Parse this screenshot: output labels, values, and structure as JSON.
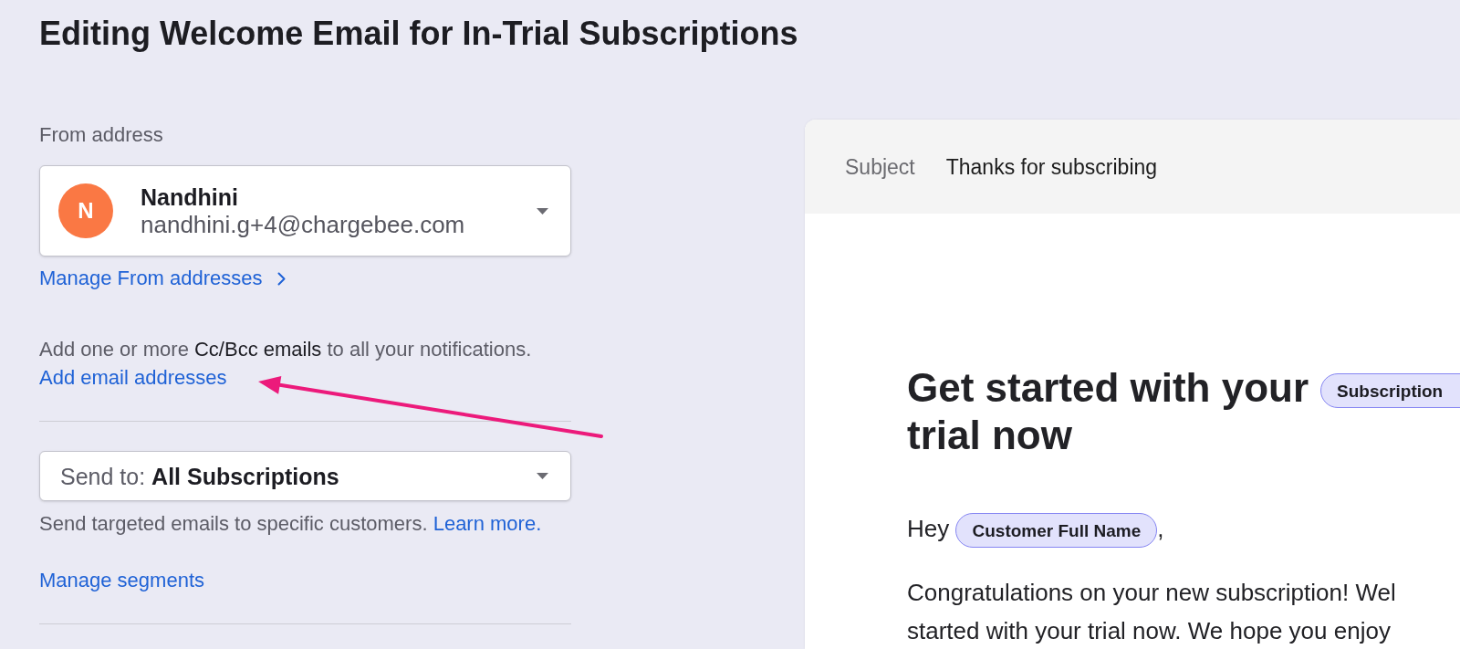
{
  "page": {
    "title": "Editing Welcome Email for In-Trial Subscriptions"
  },
  "from_address": {
    "label": "From address",
    "sender": {
      "initial": "N",
      "name": "Nandhini",
      "email": "nandhini.g+4@chargebee.com"
    },
    "manage_link": "Manage From addresses"
  },
  "cc_bcc": {
    "text": "Add one or more **Cc/Bcc emails** to all your notifications.",
    "link": "Add email addresses"
  },
  "send_to": {
    "label": "Send to:",
    "value": "All Subscriptions",
    "help": "Send targeted emails to specific customers.",
    "learn_more": "Learn more.",
    "manage_link": "Manage segments"
  },
  "preview": {
    "subject_label": "Subject",
    "subject": "Thanks for subscribing",
    "heading": {
      "line_1": "Get started with your",
      "tag": "Subscription",
      "line_2": "trial now"
    },
    "greeting": {
      "text": "Hey",
      "tag": "Customer Full Name",
      "after": ","
    },
    "body_lines": [
      "Congratulations on your new subscription! Wel",
      "started with your trial now. We hope you enjoy"
    ]
  }
}
